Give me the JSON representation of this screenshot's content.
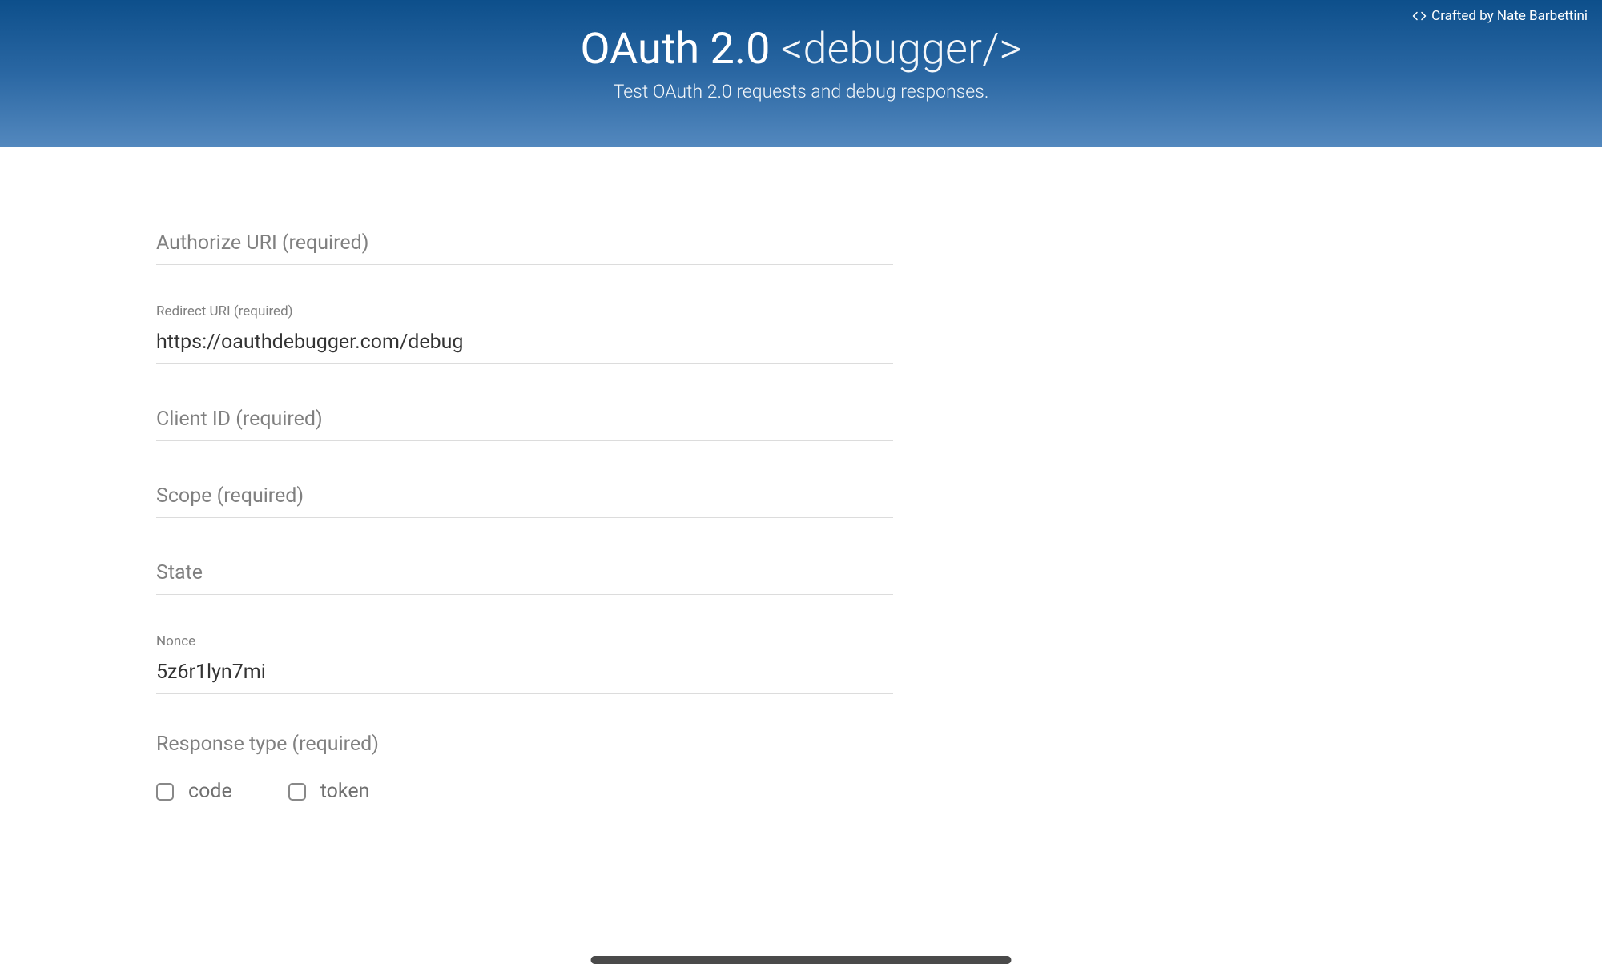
{
  "header": {
    "credit_text": "Crafted by Nate Barbettini",
    "title_bold": "OAuth 2.0 ",
    "title_light": "<debugger/>",
    "subtitle": "Test OAuth 2.0 requests and debug responses."
  },
  "form": {
    "authorize_uri": {
      "placeholder": "Authorize URI (required)",
      "value": ""
    },
    "redirect_uri": {
      "label": "Redirect URI (required)",
      "value": "https://oauthdebugger.com/debug"
    },
    "client_id": {
      "placeholder": "Client ID (required)",
      "value": ""
    },
    "scope": {
      "placeholder": "Scope (required)",
      "value": ""
    },
    "state": {
      "placeholder": "State",
      "value": ""
    },
    "nonce": {
      "label": "Nonce",
      "value": "5z6r1lyn7mi"
    },
    "response_type": {
      "label": "Response type (required)",
      "options": [
        {
          "label": "code",
          "checked": false
        },
        {
          "label": "token",
          "checked": false
        }
      ]
    }
  }
}
